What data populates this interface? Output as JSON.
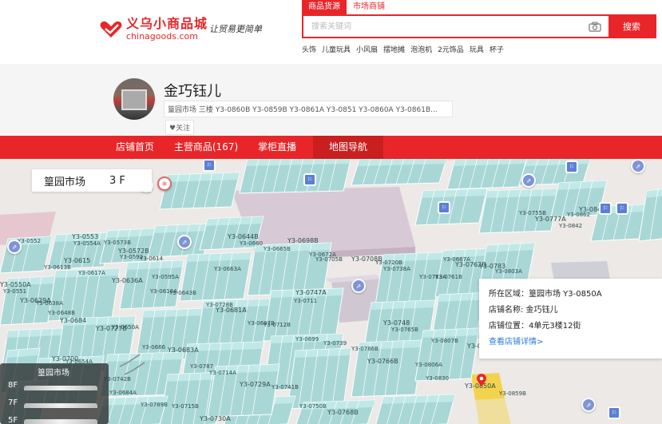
{
  "header": {
    "logo_cn": "义乌小商品城",
    "logo_en": "chinagoods.com",
    "slogan": "让贸易更简单",
    "search_tabs": [
      "商品货源",
      "市场商铺"
    ],
    "search_placeholder": "搜索关键词",
    "search_button": "搜索",
    "hotwords": [
      "头饰",
      "儿童玩具",
      "小风扇",
      "摆地摊",
      "泡泡机",
      "2元饰品",
      "玩具",
      "杯子"
    ]
  },
  "shop": {
    "name": "金巧钰儿",
    "address": "篁园市场 三楼 Y3-0860B Y3-0859B Y3-0861A Y3-0851 Y3-0860A Y3-0861B...",
    "follow_label": "♥关注"
  },
  "nav": {
    "items": [
      {
        "label": "店铺首页",
        "active": false
      },
      {
        "label": "主营商品(167)",
        "active": false
      },
      {
        "label": "掌柜直播",
        "active": false
      },
      {
        "label": "地图导航",
        "active": true
      }
    ]
  },
  "map": {
    "market": "篁园市场",
    "floor": "3 F",
    "info_card": {
      "region": "所在区域：篁园市场 Y3-0850A",
      "shop_name": "店铺名称: 金巧钰儿",
      "position": "店铺位置：4单元3楼12街",
      "detail_link": "查看店铺详情>"
    },
    "floor_panel": {
      "title": "篁园市场",
      "floors": [
        "8F",
        "7F",
        "5F"
      ]
    },
    "stall_labels": [
      "Y3-0550A",
      "Y3-0551",
      "Y3-0552",
      "Y3-0553",
      "Y3-0554A",
      "Y3-0573B",
      "Y3-0572B",
      "Y3-0592",
      "Y3-0614",
      "Y3-0615",
      "Y3-0613B",
      "Y3-0617A",
      "Y3-0636A",
      "Y3-0595A",
      "Y3-0616A",
      "Y3-0629A",
      "Y3-0638A",
      "Y3-0648B",
      "Y3-0684",
      "Y3-0643B",
      "Y3-0663A",
      "Y3-0644B",
      "Y3-0660",
      "Y3-0665B",
      "Y3-0698B",
      "Y3-0672A",
      "Y3-0705B",
      "Y3-0708B",
      "Y3-0720B",
      "Y3-0738A",
      "Y3-0747A",
      "Y3-0711",
      "Y3-0728B",
      "Y3-0681A",
      "Y3-0687B",
      "Y3-0712B",
      "Y3-0727B",
      "Y3-0650A",
      "Y3-0666",
      "Y3-0683A",
      "Y3-0699",
      "Y3-0739",
      "Y3-0748",
      "Y3-0765B",
      "Y3-0786B",
      "Y3-0766B",
      "Y3-0787",
      "Y3-0714A",
      "Y3-0729A",
      "Y3-0741B",
      "Y3-0750B",
      "Y3-0768B",
      "Y3-0789B",
      "Y3-0715B",
      "Y3-0730A",
      "Y3-0742B",
      "Y3-0684A",
      "Y3-0700",
      "Y3-0654A",
      "Y3-0667A",
      "Y3-0762B",
      "Y3-0783A",
      "Y3-0761B",
      "Y3-0783",
      "Y3-0803A",
      "Y3-0807B",
      "Y3-0829B",
      "Y3-0806A",
      "Y3-0830",
      "Y3-0850A",
      "Y3-0859B",
      "Y3-0755B",
      "Y3-0777A",
      "Y3-0842",
      "Y3-0862",
      "Y3-0844"
    ]
  },
  "colors": {
    "brand_red": "#e8262a",
    "stall_fill": "#a9d7d6",
    "stall_top": "#c6ecea",
    "map_bg": "#ece9e6",
    "link_blue": "#2a7ae2"
  }
}
